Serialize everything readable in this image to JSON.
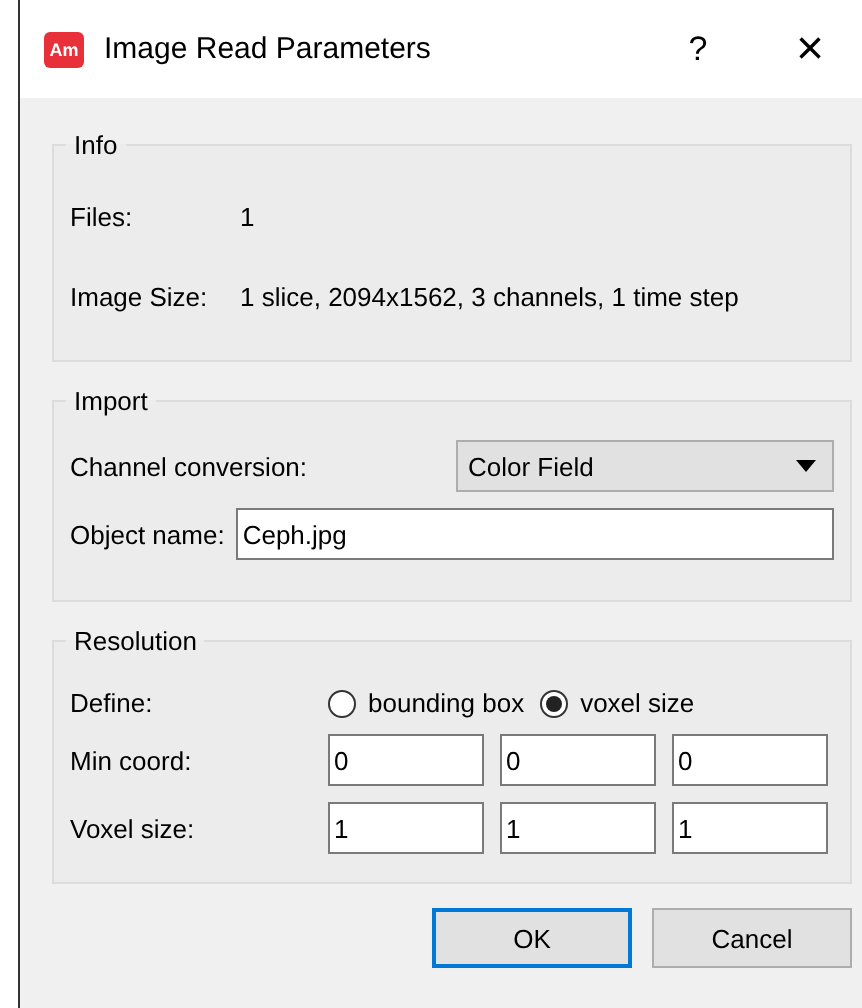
{
  "window": {
    "logo": "Am",
    "title": "Image Read Parameters",
    "help": "?",
    "close": "×"
  },
  "info": {
    "title": "Info",
    "rows": [
      {
        "label": "Files:",
        "value": "1"
      },
      {
        "label": "Image Size:",
        "value": "1 slice, 2094x1562, 3 channels, 1 time step"
      }
    ]
  },
  "import": {
    "title": "Import",
    "channel_conversion": {
      "label": "Channel conversion:",
      "value": "Color Field"
    },
    "object_name": {
      "label": "Object name:",
      "value": "Ceph.jpg"
    }
  },
  "resolution": {
    "title": "Resolution",
    "define": {
      "label": "Define:",
      "options": [
        {
          "label": "bounding box",
          "selected": false
        },
        {
          "label": "voxel size",
          "selected": true
        }
      ]
    },
    "rows": [
      {
        "label": "Min coord:",
        "values": [
          "0",
          "0",
          "0"
        ]
      },
      {
        "label": "Voxel size:",
        "values": [
          "1",
          "1",
          "1"
        ]
      }
    ]
  },
  "buttons": [
    {
      "label": "OK",
      "default": true
    },
    {
      "label": "Cancel",
      "default": false
    }
  ]
}
